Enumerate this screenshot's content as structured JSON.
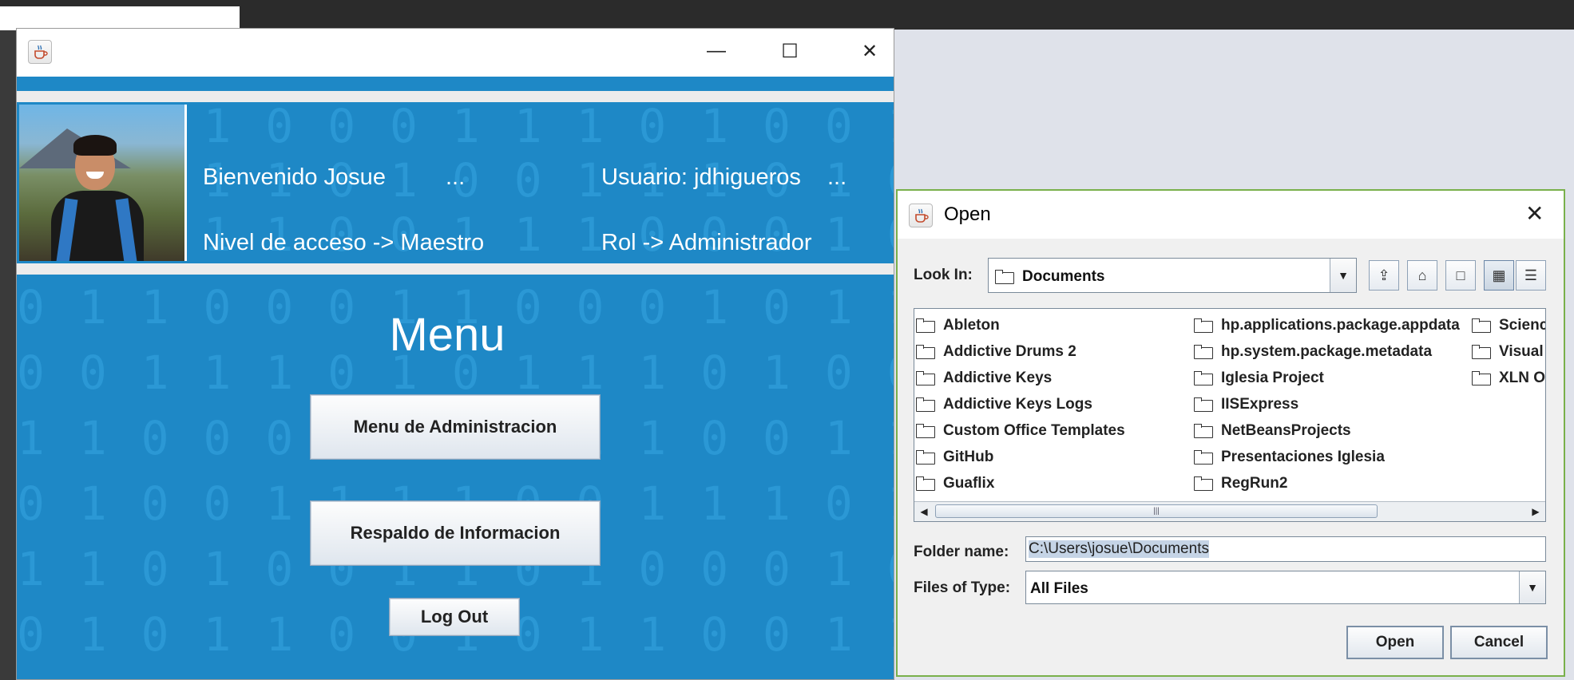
{
  "main_window": {
    "header": {
      "welcome": "Bienvenido Josue",
      "welcome_more": "...",
      "user": "Usuario: jdhigueros",
      "user_more": "...",
      "access_level": "Nivel de acceso -> Maestro",
      "role": "Rol -> Administrador"
    },
    "menu_title": "Menu",
    "buttons": {
      "admin": "Menu de Administracion",
      "backup": "Respaldo de Informacion",
      "logout": "Log Out"
    },
    "binary_rows": [
      "0 1 1 0 0 0 1 1 0 0 0 1 0 1 1 0 0 0 1 0 1 1",
      "0 0 1 1 1 0 1 0 1 1 1 0 1 0 0 1 1 1 0 1 0 0 1",
      "1 1 0 0 0 1 0 1 0 1 1 0 0 1 1 0 0 1 0 1 1 0 0",
      "0 1 0 0 1 1 1 1 0 0 1 1 1 0 1 0 0 1 1 1 0 1 0 0",
      "1 1 0 1 0 0 1 1 0 1 0 0 0 1 0 1 0 0 1 1 0 1 0",
      "0 1 0 1 1 0 0 1 0 1 1 0 0 1 1 1 0 0 0 1 0 1",
      "0 1 1 0 0 0 1 1 0 0 0 1 0 1 1 0 0 0 1 0 1 1"
    ],
    "header_binary_rows": [
      "0 0 0 1 0 0 0 1 1 1 0 1 0 0 1 1 0 1 0 0 1",
      "0 0 1 1 1 0 1 0 0 1 1 1 0 1 0 0 1 1 1 0 1 0",
      "1 0 1 1 1 0 0 1 1 1 0 0 0 1 0 1 1 1 0 0 1 0"
    ]
  },
  "open_dialog": {
    "title": "Open",
    "look_in_label": "Look In:",
    "look_in_value": "Documents",
    "columns": [
      [
        "Ableton",
        "Addictive Drums 2",
        "Addictive Keys",
        "Addictive Keys Logs",
        "Custom Office Templates",
        "GitHub",
        "Guaflix"
      ],
      [
        "hp.applications.package.appdata",
        "hp.system.package.metadata",
        "Iglesia Project",
        "IISExpress",
        "NetBeansProjects",
        "Presentaciones Iglesia",
        "RegRun2"
      ],
      [
        "Scienc",
        "Visual",
        "XLN O"
      ]
    ],
    "folder_name_label": "Folder name:",
    "folder_name_value": "C:\\Users\\josue\\Documents",
    "files_of_type_label": "Files of Type:",
    "files_of_type_value": "All Files",
    "open_button": "Open",
    "cancel_button": "Cancel"
  },
  "icons": {
    "java_app": "java-cup-icon",
    "folder": "folder-icon"
  },
  "colors": {
    "accent_blue": "#1e88c6",
    "binary_text": "#2b98d5",
    "dialog_border": "#79b04b"
  }
}
